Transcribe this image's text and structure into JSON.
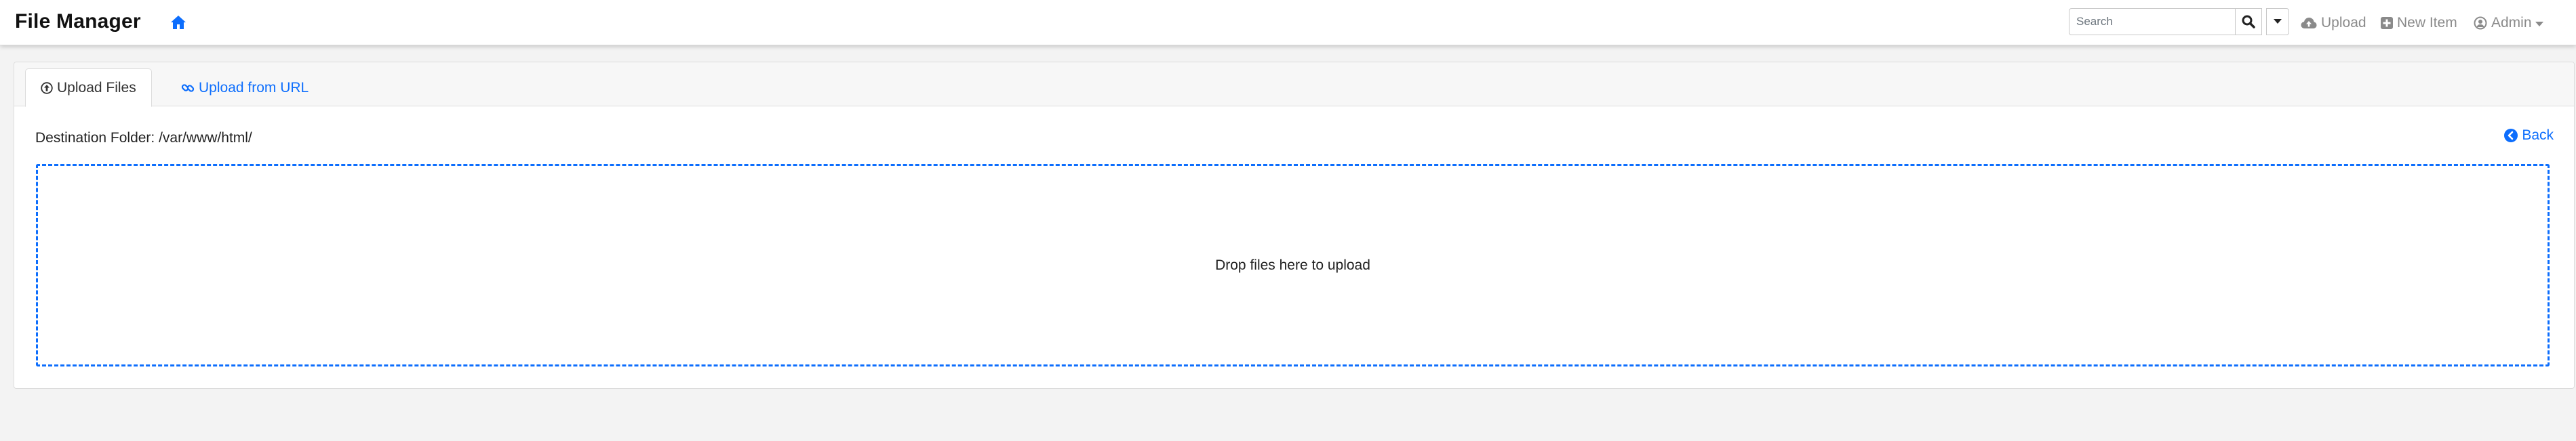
{
  "navbar": {
    "brand": "File Manager",
    "search": {
      "placeholder": "Search",
      "value": ""
    },
    "upload_label": "Upload",
    "new_item_label": "New Item",
    "admin_label": "Admin",
    "icons": {
      "home": "home-icon",
      "search": "search-icon",
      "dropdown": "caret-down-icon",
      "upload": "cloud-upload-icon",
      "new_item": "plus-square-icon",
      "admin": "user-circle-icon"
    }
  },
  "tabs": [
    {
      "label": "Upload Files",
      "icon": "arrow-circle-up-icon",
      "active": true
    },
    {
      "label": "Upload from URL",
      "icon": "link-icon",
      "active": false
    }
  ],
  "upload": {
    "destination_label": "Destination Folder: /var/www/html/",
    "back_label": "Back",
    "dropzone_text": "Drop files here to upload"
  },
  "colors": {
    "accent": "#0d6efd",
    "muted": "#8a8a8a",
    "background": "#f3f3f3"
  }
}
